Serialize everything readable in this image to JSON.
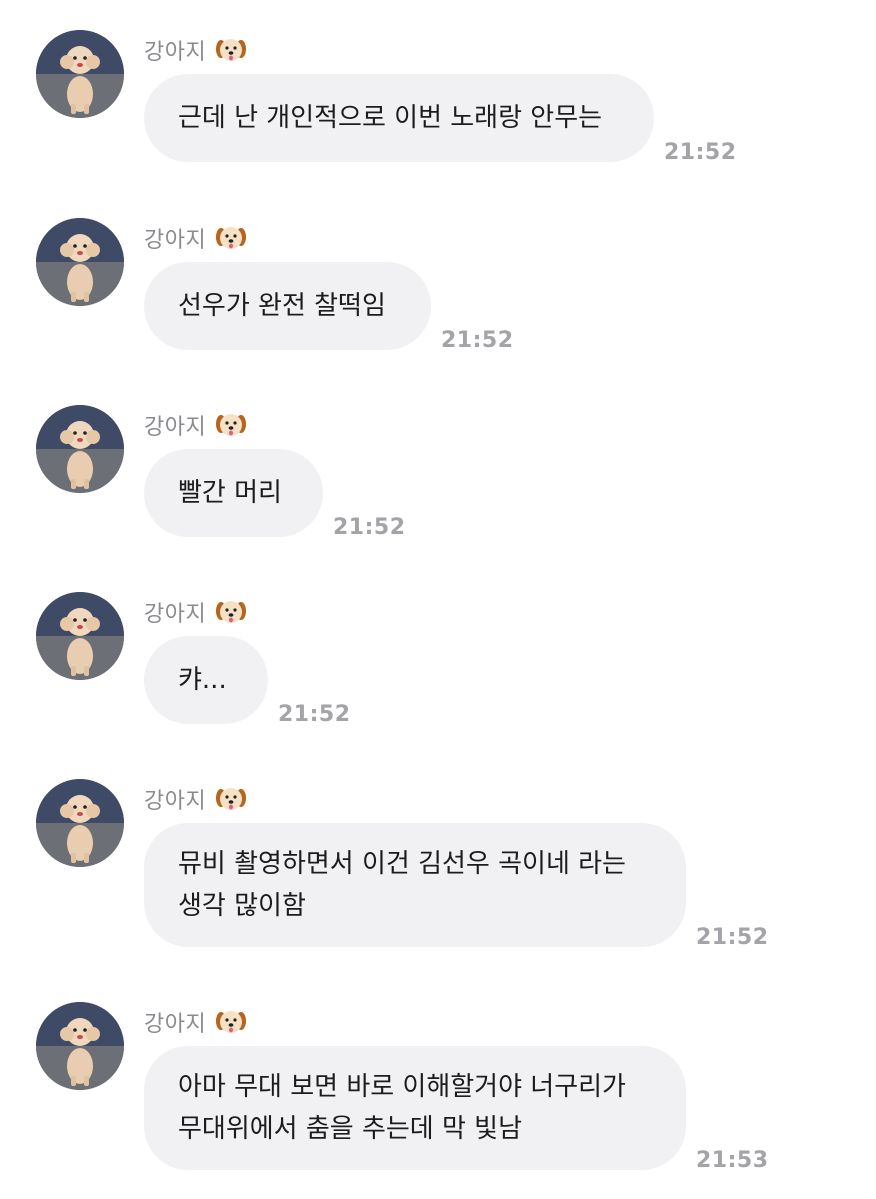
{
  "conversation": {
    "messages": [
      {
        "sender": "강아지",
        "sender_icon": "dog-face-icon",
        "lines": [
          "근데 난 개인적으로 이번 노래랑 안무는"
        ],
        "time": "21:52"
      },
      {
        "sender": "강아지",
        "sender_icon": "dog-face-icon",
        "lines": [
          "선우가 완전 찰떡임"
        ],
        "time": "21:52"
      },
      {
        "sender": "강아지",
        "sender_icon": "dog-face-icon",
        "lines": [
          "빨간 머리"
        ],
        "time": "21:52"
      },
      {
        "sender": "강아지",
        "sender_icon": "dog-face-icon",
        "lines": [
          "캬..."
        ],
        "time": "21:52"
      },
      {
        "sender": "강아지",
        "sender_icon": "dog-face-icon",
        "lines": [
          "뮤비 촬영하면서 이건 김선우 곡이네 라는",
          "생각 많이함"
        ],
        "time": "21:52"
      },
      {
        "sender": "강아지",
        "sender_icon": "dog-face-icon",
        "lines": [
          "아마 무대 보면 바로 이해할거야 너구리가",
          "무대위에서 춤을 추는데 막 빛남"
        ],
        "time": "21:53"
      }
    ]
  },
  "colors": {
    "bubble": "#f1f1f3",
    "sender_text": "#8a8a8f",
    "time_text": "#a3a3a8",
    "message_text": "#1c1c1e"
  }
}
